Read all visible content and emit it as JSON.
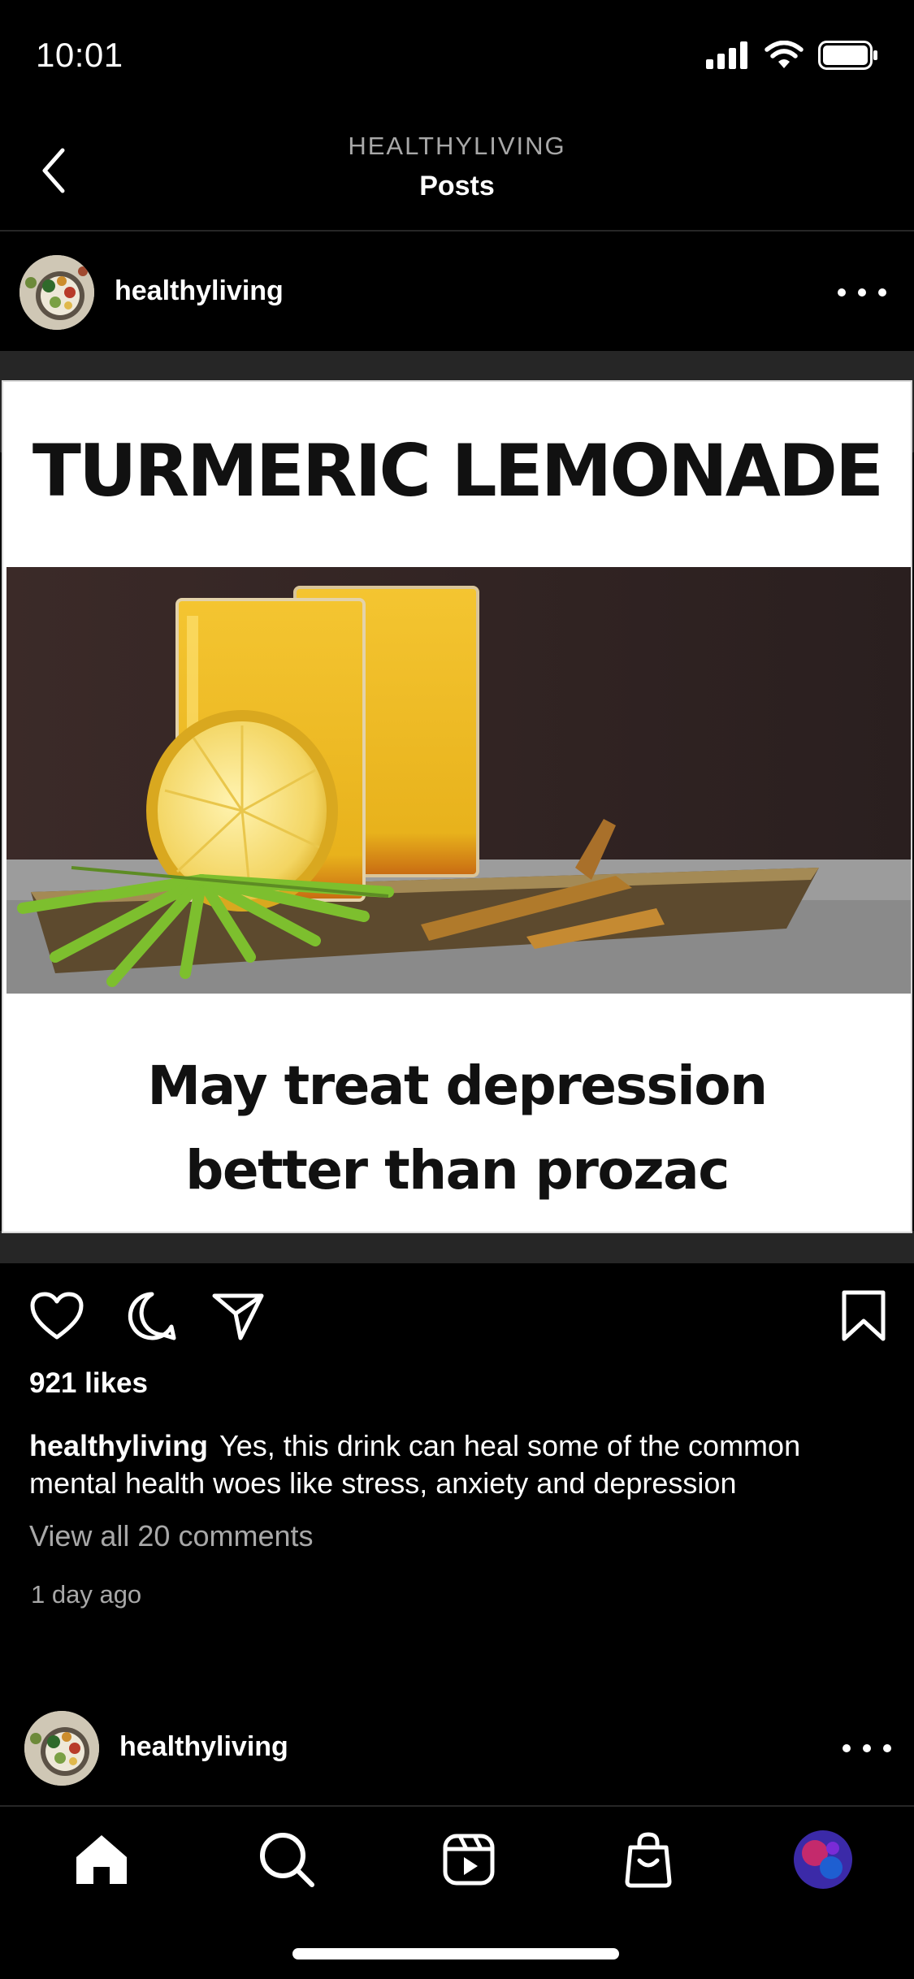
{
  "status_bar": {
    "time": "10:01",
    "icons": [
      "signal-icon",
      "wifi-icon",
      "battery-icon"
    ]
  },
  "nav": {
    "overline": "HEALTHYLIVING",
    "title": "Posts",
    "back_icon": "chevron-left-icon"
  },
  "post": {
    "username": "healthyliving",
    "media": {
      "headline": "TURMERIC LEMONADE",
      "caption_line1": "May treat depression",
      "caption_line2": "better than prozac"
    },
    "actions": [
      "heart-icon",
      "comment-icon",
      "share-icon",
      "bookmark-icon"
    ],
    "likes": "921 likes",
    "caption_user": "healthyliving",
    "caption_text": "Yes, this drink can heal some of the common mental health woes like stress, anxiety and depression",
    "view_comments": "View all 20 comments",
    "timestamp": "1 day ago"
  },
  "next_post": {
    "username": "healthyliving"
  },
  "tab_bar": {
    "tabs": [
      "home-icon",
      "search-icon",
      "reels-icon",
      "shop-icon",
      "profile-avatar"
    ],
    "active": "home-icon"
  },
  "colors": {
    "background": "#000000",
    "divider": "#262626",
    "secondary_text": "#a8a8a8"
  }
}
